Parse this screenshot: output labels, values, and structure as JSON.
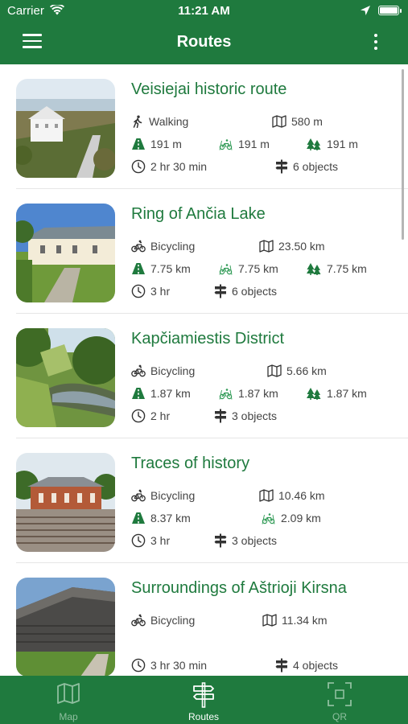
{
  "status_bar": {
    "carrier": "Carrier",
    "time": "11:21 AM"
  },
  "nav": {
    "title": "Routes"
  },
  "routes": [
    {
      "name": "Veisiejai historic route",
      "type": "Walking",
      "type_icon": "walking-icon",
      "length": "580 m",
      "walk": "191 m",
      "bike": "191 m",
      "forest": "191 m",
      "duration": "2 hr 30 min",
      "objects": "6 objects"
    },
    {
      "name": "Ring of Ančia Lake",
      "type": "Bicycling",
      "type_icon": "bicycle-icon",
      "length": "23.50 km",
      "walk": "7.75 km",
      "bike": "7.75 km",
      "forest": "7.75 km",
      "duration": "3 hr",
      "objects": "6 objects"
    },
    {
      "name": "Kapčiamiestis District",
      "type": "Bicycling",
      "type_icon": "bicycle-icon",
      "length": "5.66 km",
      "walk": "1.87 km",
      "bike": "1.87 km",
      "forest": "1.87 km",
      "duration": "2 hr",
      "objects": "3 objects"
    },
    {
      "name": "Traces of history",
      "type": "Bicycling",
      "type_icon": "bicycle-icon",
      "length": "10.46 km",
      "walk": "8.37 km",
      "bike": "2.09 km",
      "duration": "3 hr",
      "objects": "3 objects"
    },
    {
      "name": "Surroundings of Aštrioji Kirsna",
      "type": "Bicycling",
      "type_icon": "bicycle-icon",
      "length": "11.34 km",
      "duration": "3 hr 30 min",
      "objects": "4 objects"
    }
  ],
  "tabs": [
    {
      "label": "Map",
      "icon": "map-icon",
      "active": false
    },
    {
      "label": "Routes",
      "icon": "signpost-icon",
      "active": true
    },
    {
      "label": "QR",
      "icon": "qr-scan-icon",
      "active": false
    }
  ],
  "colors": {
    "brand_green": "#1f7a3e",
    "text": "#444444",
    "divider": "#e6e6e6"
  }
}
